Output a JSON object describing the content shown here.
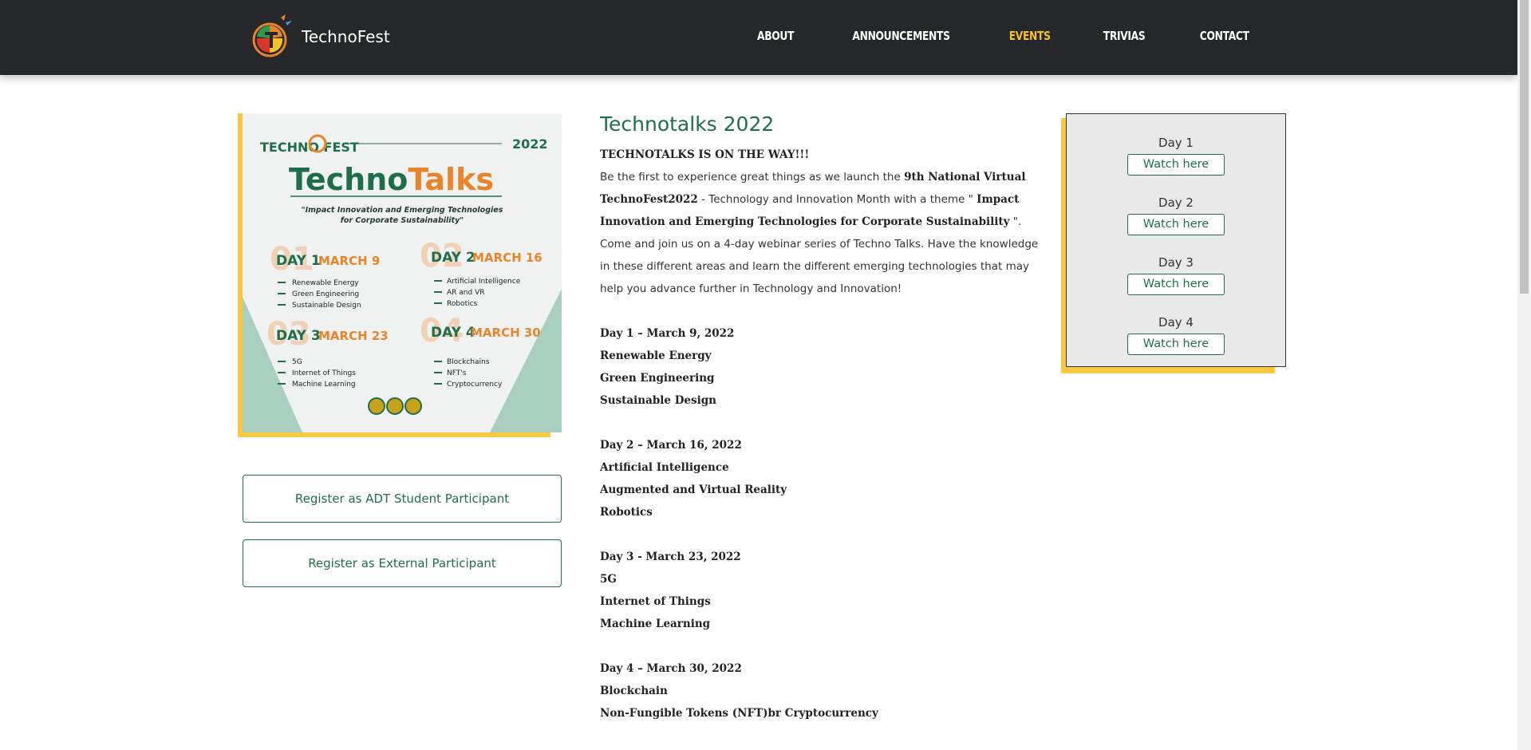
{
  "brand": {
    "name": "TechnoFest"
  },
  "nav": {
    "items": [
      "ABOUT",
      "ANNOUNCEMENTS",
      "EVENTS",
      "TRIVIAS",
      "CONTACT"
    ],
    "active": "EVENTS"
  },
  "poster": {
    "fest_logo": "TECHNO FEST",
    "year": "2022",
    "title_part1": "Techno",
    "title_part2": "Talks",
    "theme_line1": "\"Impact Innovation and Emerging Technologies",
    "theme_line2": "for Corporate Sustainability\"",
    "days": [
      {
        "num": "01",
        "label": "DAY 1",
        "date": "MARCH 9",
        "topics": [
          "Renewable Energy",
          "Green Engineering",
          "Sustainable Design"
        ]
      },
      {
        "num": "02",
        "label": "DAY 2",
        "date": "MARCH 16",
        "topics": [
          "Artificial Intelligence",
          "AR and VR",
          "Robotics"
        ]
      },
      {
        "num": "03",
        "label": "DAY 3",
        "date": "MARCH 23",
        "topics": [
          "5G",
          "Internet of Things",
          "Machine Learning"
        ]
      },
      {
        "num": "04",
        "label": "DAY 4",
        "date": "MARCH 30",
        "topics": [
          "Blockchains",
          "NFT's",
          "Cryptocurrency"
        ]
      }
    ]
  },
  "register": {
    "student": "Register as ADT Student Participant",
    "external": "Register as External Participant"
  },
  "article": {
    "title": "Technotalks 2022",
    "headline": "TECHNOTALKS IS ON THE WAY!!!",
    "intro_1": "Be the first to experience great things as we launch the ",
    "intro_bold_1": "9th National Virtual TechnoFest2022",
    "intro_2": " - Technology and Innovation Month with a theme \" ",
    "intro_bold_2": "Impact Innovation and Emerging Technologies for Corporate Sustainability",
    "intro_3": " \".",
    "intro_4": "Come and join us on a 4-day webinar series of Techno Talks. Have the knowledge in these different areas and learn the different emerging technologies that may help you advance further in Technology and Innovation!",
    "day1": {
      "heading": "Day 1 – March 9, 2022",
      "topics": [
        "Renewable Energy",
        "Green Engineering",
        "Sustainable Design"
      ]
    },
    "day2": {
      "heading": "Day 2 – March 16, 2022",
      "topics": [
        "Artificial Intelligence",
        "Augmented and Virtual Reality",
        "Robotics"
      ]
    },
    "day3": {
      "heading": "Day 3 - March 23, 2022",
      "topics": [
        "5G",
        "Internet of Things",
        "Machine Learning"
      ]
    },
    "day4": {
      "heading": "Day 4 – March 30, 2022",
      "topics": [
        "Blockchain",
        "Non-Fungible Tokens (NFT)br Cryptocurrency"
      ]
    }
  },
  "watch": {
    "days": [
      {
        "label": "Day 1",
        "button": "Watch here"
      },
      {
        "label": "Day 2",
        "button": "Watch here"
      },
      {
        "label": "Day 3",
        "button": "Watch here"
      },
      {
        "label": "Day 4",
        "button": "Watch here"
      }
    ]
  },
  "colors": {
    "header_bg": "#25272a",
    "accent_yellow": "#f6c02a",
    "brand_green": "#1f6e4a",
    "orange": "#e8852a"
  }
}
